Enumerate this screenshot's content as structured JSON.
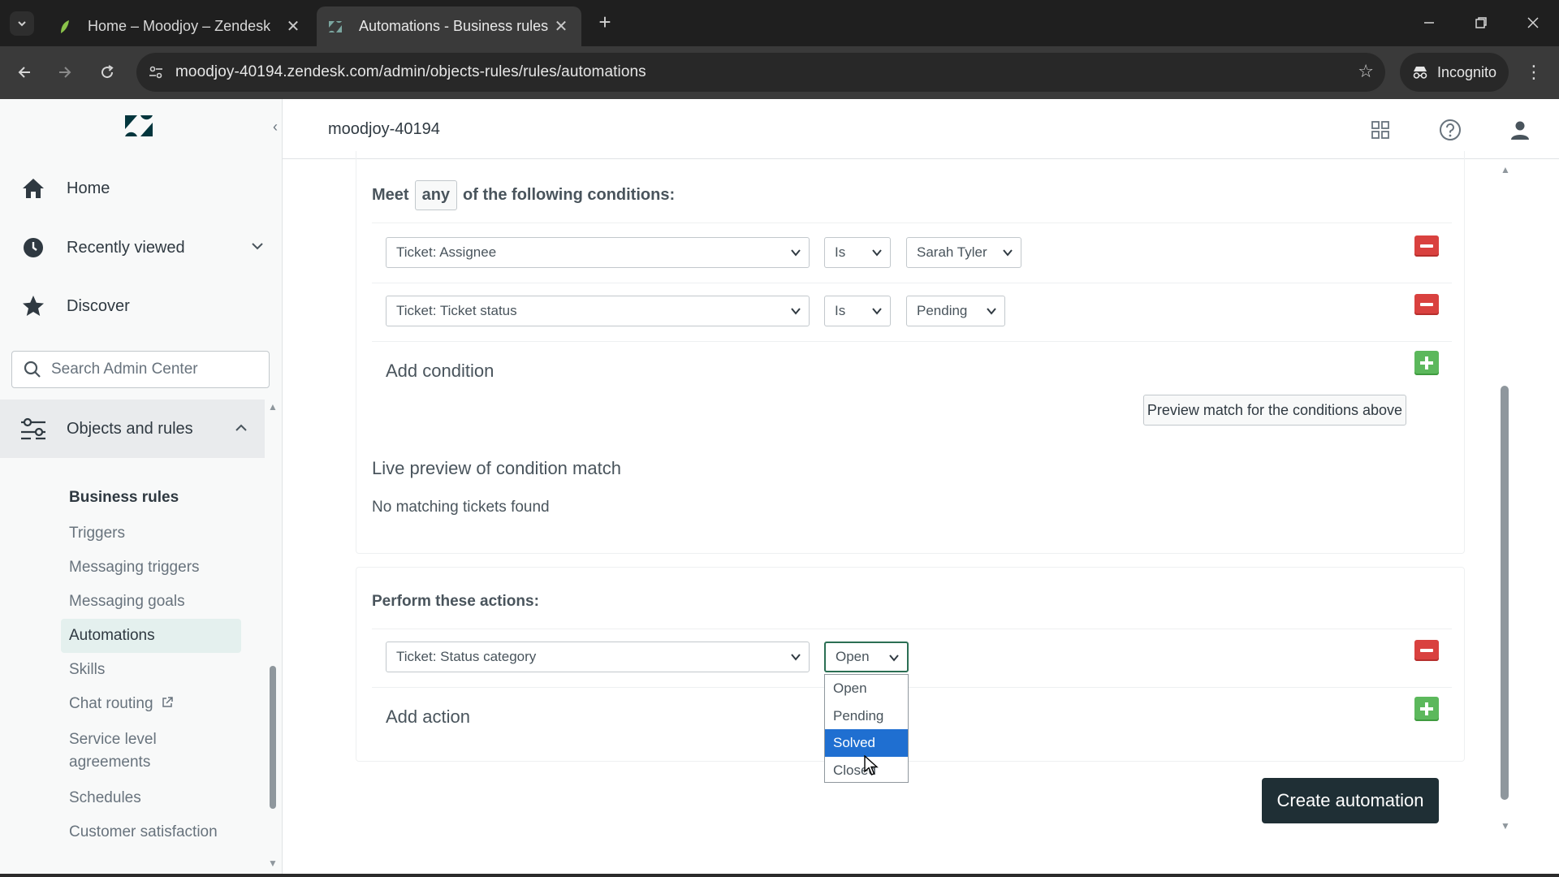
{
  "browser": {
    "tabs": [
      {
        "title": "Home – Moodjoy – Zendesk",
        "active": false
      },
      {
        "title": "Automations - Business rules -",
        "active": true
      }
    ],
    "url": "moodjoy-40194.zendesk.com/admin/objects-rules/rules/automations",
    "incognito_label": "Incognito"
  },
  "sidebar": {
    "nav": [
      {
        "label": "Home",
        "icon": "home-icon"
      },
      {
        "label": "Recently viewed",
        "icon": "clock-icon"
      },
      {
        "label": "Discover",
        "icon": "star-icon"
      }
    ],
    "search_placeholder": "Search Admin Center",
    "section_label": "Objects and rules",
    "sub_heading": "Business rules",
    "sub_items": [
      {
        "label": "Triggers"
      },
      {
        "label": "Messaging triggers"
      },
      {
        "label": "Messaging goals"
      },
      {
        "label": "Automations",
        "active": true
      },
      {
        "label": "Skills"
      },
      {
        "label": "Chat routing"
      },
      {
        "label": "Service level"
      },
      {
        "label": "agreements"
      },
      {
        "label": "Schedules"
      },
      {
        "label": "Customer satisfaction"
      }
    ]
  },
  "header": {
    "account": "moodjoy-40194"
  },
  "conditions": {
    "meet_prefix": "Meet",
    "meet_mode": "any",
    "meet_suffix": "of the following conditions:",
    "rows": [
      {
        "field": "Ticket: Assignee",
        "operator": "Is",
        "value": "Sarah Tyler"
      },
      {
        "field": "Ticket: Ticket status",
        "operator": "Is",
        "value": "Pending"
      }
    ],
    "add_label": "Add condition",
    "preview_button": "Preview match for the conditions above",
    "live_preview_title": "Live preview of condition match",
    "no_match_text": "No matching tickets found"
  },
  "actions": {
    "title": "Perform these actions:",
    "rows": [
      {
        "field": "Ticket: Status category",
        "value": "Open"
      }
    ],
    "dropdown_options": [
      "Open",
      "Pending",
      "Solved",
      "Closed"
    ],
    "dropdown_highlighted": "Solved",
    "add_label": "Add action"
  },
  "create_button": "Create automation",
  "colors": {
    "remove": "#d9413f",
    "add": "#5cb85c",
    "primary_button": "#1f2f35",
    "highlight": "#1f6fd1"
  }
}
